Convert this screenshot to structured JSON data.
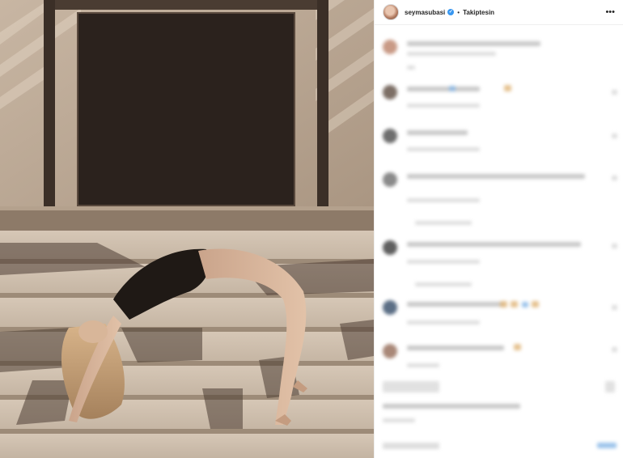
{
  "post": {
    "photo": {
      "description_icon": "photo-of-woman-in-backbend-on-stone-steps"
    },
    "header": {
      "username": "seymasubasi",
      "verified_icon": "verified-badge-icon",
      "separator": "•",
      "follow_status": "Takiptesin",
      "more_icon": "more-options-icon"
    },
    "colors": {
      "accent_blue": "#3897f0",
      "text": "#262626",
      "border": "#efefef"
    }
  }
}
